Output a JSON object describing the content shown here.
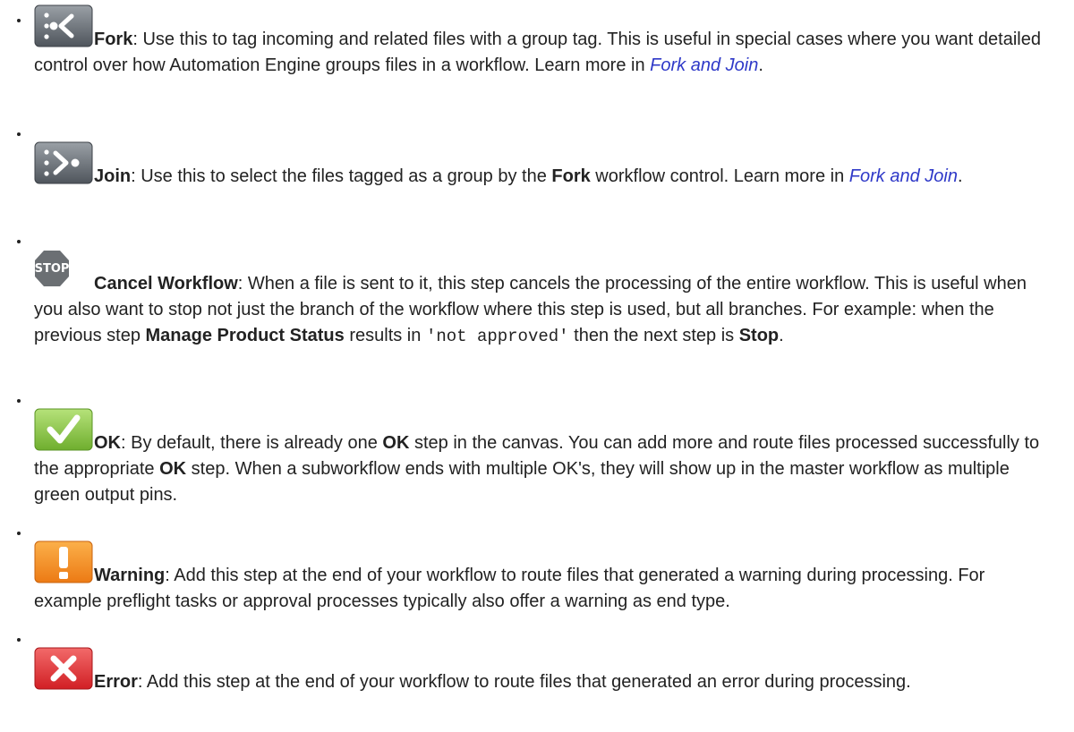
{
  "colors": {
    "text": "#222222",
    "link": "#2f39c8"
  },
  "items": [
    {
      "icon": "fork-icon",
      "name": "Fork",
      "desc_1": ": Use this to tag incoming and related files with a group tag. This is useful in special cases where you want detailed control over how Automation Engine groups files in a workflow. Learn more in ",
      "link": "Fork and Join",
      "desc_2": "."
    },
    {
      "icon": "join-icon",
      "name": "Join",
      "desc_1": ": Use this to select the files tagged as a group by the ",
      "ref": "Fork",
      "desc_2": " workflow control. Learn more in ",
      "link": "Fork and Join",
      "desc_3": "."
    },
    {
      "icon": "stop-icon",
      "icon_text": "STOP",
      "name": "Cancel Workflow",
      "desc_1": ": When a file is sent to it, this step cancels the processing of the entire workflow. This is useful when you also want to stop not just the branch of the workflow where this step is used, but all branches. For example: when the previous step ",
      "ref": "Manage Product Status",
      "desc_2": " results in ",
      "code": "'not approved'",
      "desc_3": " then the next step is ",
      "ref2": "Stop",
      "desc_4": "."
    },
    {
      "icon": "checkmark-icon",
      "name": "OK",
      "desc_1": ": By default, there is already one ",
      "ref": "OK",
      "desc_2": " step in the canvas. You can add more and route files processed successfully to the appropriate ",
      "ref2": "OK",
      "desc_3": " step. When a subworkflow ends with multiple OK's, they will show up in the master workflow as multiple green output pins."
    },
    {
      "icon": "warning-icon",
      "name": "Warning",
      "desc_1": ": Add this step at the end of your workflow to route files that generated a warning during processing. For example preflight tasks or approval processes typically also offer a warning as end type."
    },
    {
      "icon": "error-icon",
      "name": "Error",
      "desc_1": ": Add this step at the end of your workflow to route files that generated an error during processing."
    }
  ]
}
